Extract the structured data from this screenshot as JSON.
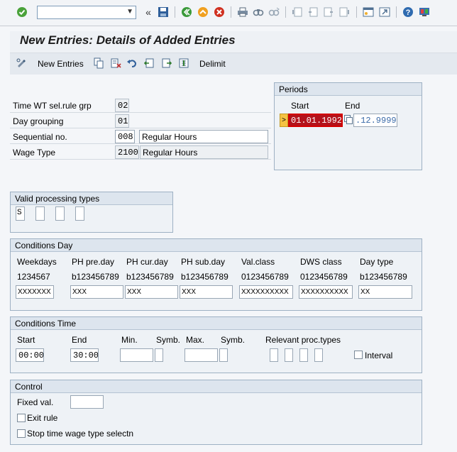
{
  "toolbar": {
    "command_field": "",
    "icons": [
      "check-icon",
      "dropdown-icon",
      "back-double-icon",
      "save-icon",
      "back-icon",
      "exit-icon",
      "cancel-icon",
      "print-icon",
      "find-icon",
      "find-next-icon",
      "first-page-icon",
      "prev-page-icon",
      "next-page-icon",
      "last-page-icon",
      "new-session-icon",
      "shortcut-icon",
      "help-icon",
      "customize-icon"
    ]
  },
  "header": {
    "title": "New Entries: Details of Added Entries"
  },
  "app_toolbar": {
    "new_entries": "New Entries",
    "delimit": "Delimit"
  },
  "fields": {
    "time_wt_label": "Time WT sel.rule grp",
    "time_wt_value": "02",
    "day_grouping_label": "Day grouping",
    "day_grouping_value": "01",
    "sequential_label": "Sequential no.",
    "sequential_value": "008",
    "sequential_text": "Regular Hours",
    "wage_type_label": "Wage Type",
    "wage_type_value": "2100",
    "wage_type_text": "Regular Hours"
  },
  "periods": {
    "title": "Periods",
    "start_label": "Start",
    "end_label": "End",
    "start_value": "01.01.1992",
    "end_value": ".12.9999"
  },
  "valid_processing": {
    "title": "Valid processing types",
    "values": [
      "S",
      "",
      "",
      ""
    ]
  },
  "conditions_day": {
    "title": "Conditions Day",
    "headers": [
      "Weekdays",
      "PH pre.day",
      "PH cur.day",
      "PH sub.day",
      "Val.class",
      "DWS class",
      "Day type"
    ],
    "hints": [
      "1234567",
      "b123456789",
      "b123456789",
      "b123456789",
      "0123456789",
      "0123456789",
      "b123456789"
    ],
    "values": [
      "XXXXXXX",
      "XXX",
      "XXX",
      "XXX",
      "XXXXXXXXXX",
      "XXXXXXXXXX",
      "XX"
    ]
  },
  "conditions_time": {
    "title": "Conditions Time",
    "start_label": "Start",
    "end_label": "End",
    "min_label": "Min.",
    "symb1_label": "Symb.",
    "max_label": "Max.",
    "symb2_label": "Symb.",
    "relevant_label": "Relevant proc.types",
    "start_value": "00:00",
    "end_value": "30:00",
    "interval_label": "Interval"
  },
  "control": {
    "title": "Control",
    "fixed_val_label": "Fixed val.",
    "fixed_val_value": "",
    "exit_rule_label": "Exit rule",
    "stop_label": "Stop time wage type selectn"
  },
  "colors": {
    "highlight_field": "#b3131b",
    "highlight_border": "#d40000",
    "marker_bg": "#f5c242"
  }
}
